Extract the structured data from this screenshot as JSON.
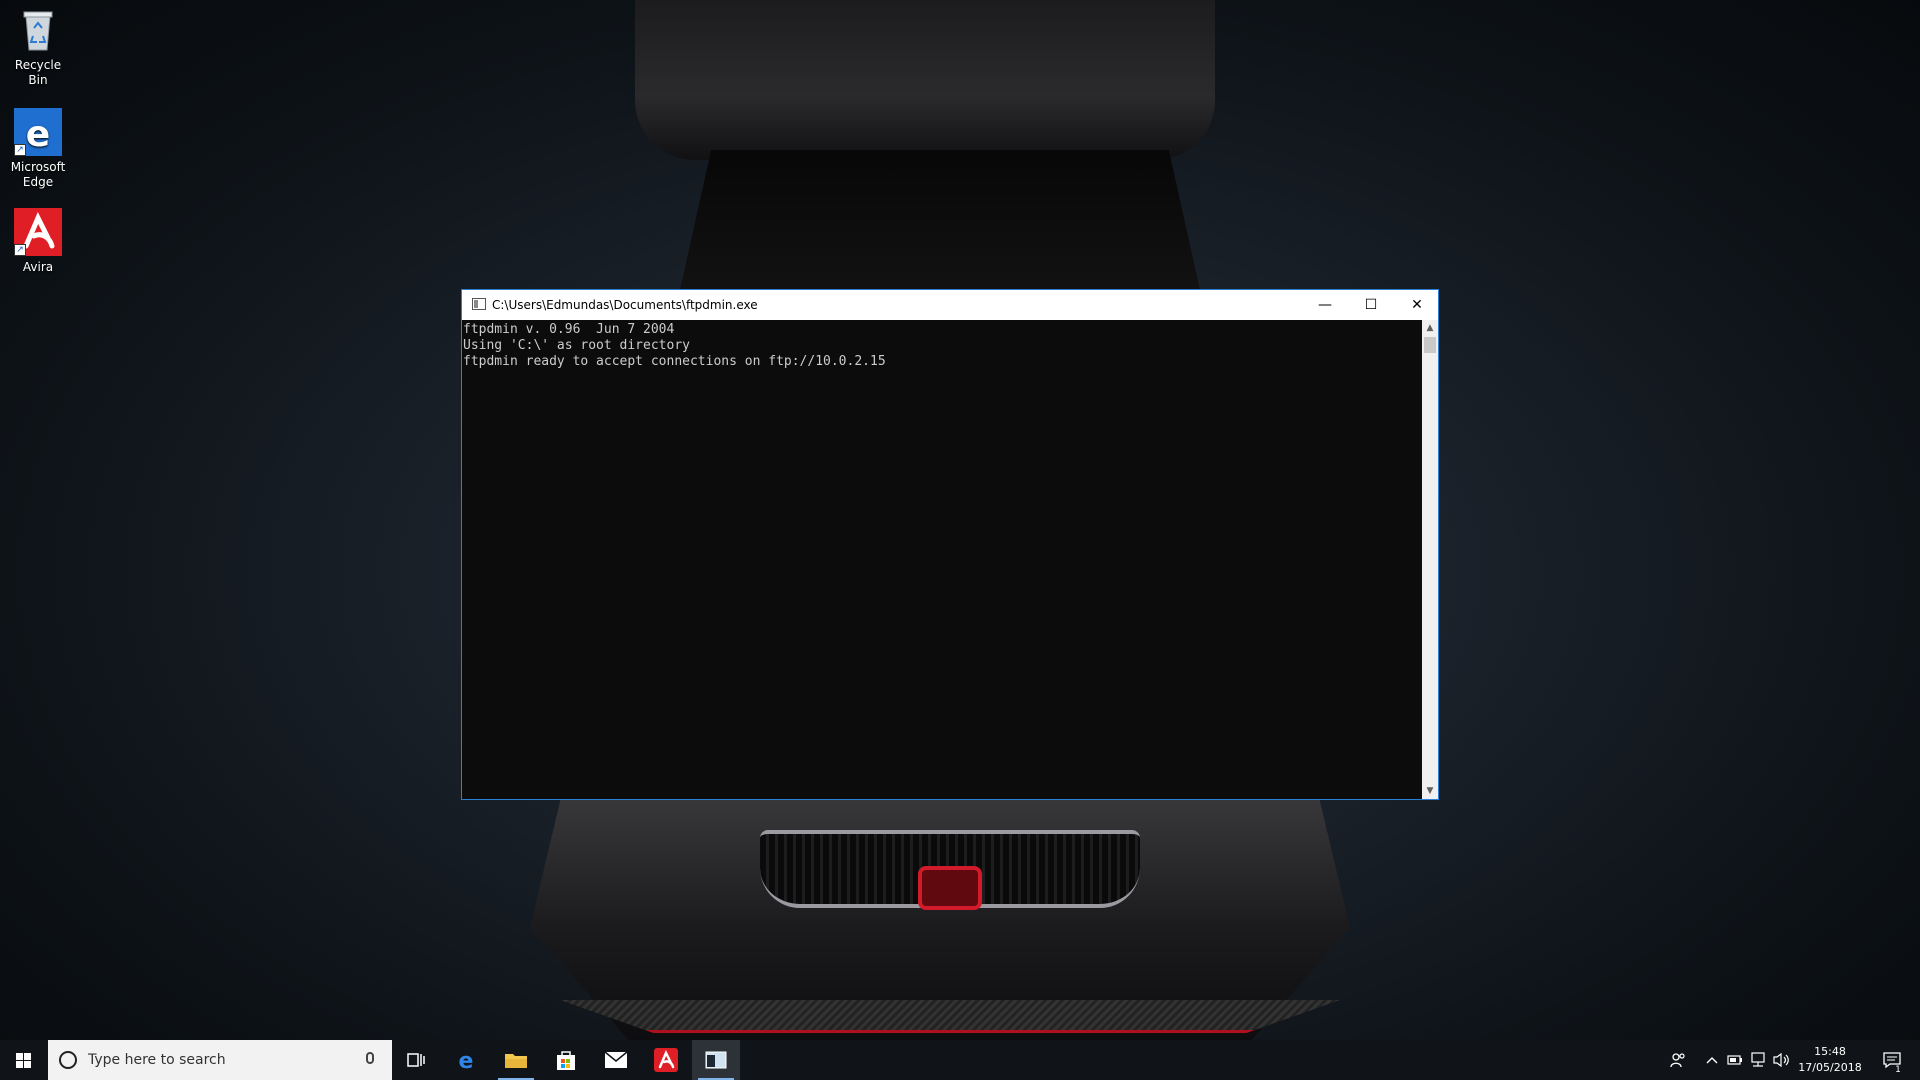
{
  "desktop": {
    "icons": [
      {
        "label": "Recycle Bin",
        "icon": "recycle-bin-icon"
      },
      {
        "label": "Microsoft Edge",
        "icon": "edge-icon"
      },
      {
        "label": "Avira",
        "icon": "avira-icon"
      }
    ]
  },
  "console": {
    "title": "C:\\Users\\Edmundas\\Documents\\ftpdmin.exe",
    "lines": [
      "ftpdmin v. 0.96  Jun 7 2004",
      "Using 'C:\\' as root directory",
      "ftpdmin ready to accept connections on ftp://10.0.2.15"
    ],
    "minimize_glyph": "—",
    "maximize_glyph": "☐",
    "close_glyph": "✕"
  },
  "taskbar": {
    "search_placeholder": "Type here to search",
    "apps": [
      "task-view-icon",
      "edge-icon",
      "file-explorer-icon",
      "store-icon",
      "mail-icon",
      "avira-icon",
      "console-icon"
    ],
    "clock_time": "15:48",
    "clock_date": "17/05/2018",
    "notification_count": "1"
  },
  "colors": {
    "accent": "#2a7fd6",
    "console_bg": "#0c0c0c",
    "console_text": "#cccccc",
    "taskbar": "#101418"
  }
}
